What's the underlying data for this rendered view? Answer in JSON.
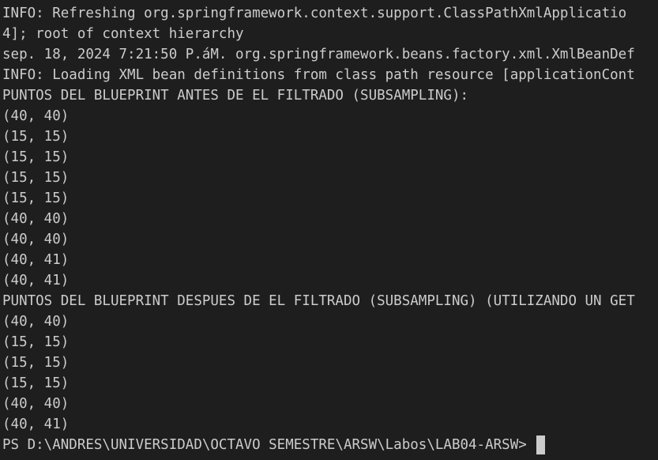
{
  "terminal": {
    "lines": [
      "INFO: Refreshing org.springframework.context.support.ClassPathXmlApplicatio",
      "4]; root of context hierarchy",
      "sep. 18, 2024 7:21:50 P.áM. org.springframework.beans.factory.xml.XmlBeanDef",
      "INFO: Loading XML bean definitions from class path resource [applicationCont",
      "PUNTOS DEL BLUEPRINT ANTES DE EL FILTRADO (SUBSAMPLING):",
      "(40, 40)",
      "(15, 15)",
      "(15, 15)",
      "(15, 15)",
      "(15, 15)",
      "(40, 40)",
      "(40, 40)",
      "(40, 41)",
      "(40, 41)",
      "PUNTOS DEL BLUEPRINT DESPUES DE EL FILTRADO (SUBSAMPLING) (UTILIZANDO UN GET",
      "(40, 40)",
      "(15, 15)",
      "(15, 15)",
      "(15, 15)",
      "(40, 40)",
      "(40, 41)"
    ],
    "prompt": "PS D:\\ANDRES\\UNIVERSIDAD\\OCTAVO SEMESTRE\\ARSW\\Labos\\LAB04-ARSW> ",
    "colors": {
      "background": "#1e1e1e",
      "foreground": "#cccccc"
    }
  }
}
